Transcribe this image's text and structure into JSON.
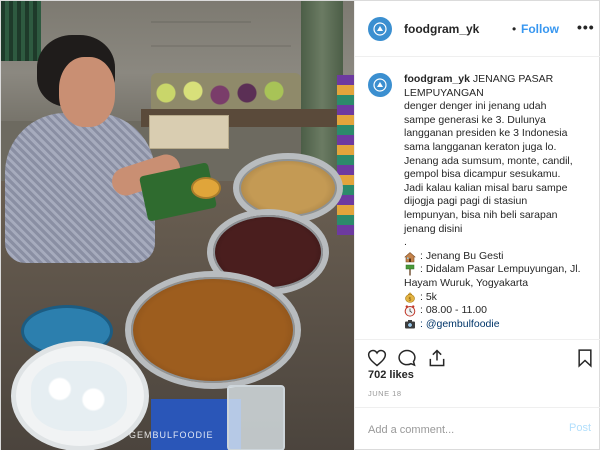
{
  "post": {
    "username": "foodgram_yk",
    "dot": "•",
    "follow_label": "Follow",
    "more_label": "•••",
    "caption": {
      "username": "foodgram_yk",
      "lines": [
        "JENANG PASAR",
        "LEMPUYANGAN",
        "denger denger ini jenang udah",
        "sampe generasi ke 3. Dulunya",
        "langganan presiden ke 3 Indonesia",
        "sama langganan keraton juga lo.",
        "Jenang ada sumsum, monte, candil,",
        "gempol bisa dicampur sesukamu.",
        "Jadi kalau kalian misal baru sampe",
        "dijogja pagi pagi di stasiun",
        "lempunyan, bisa nih beli sarapan",
        "jenang disini",
        "."
      ],
      "details": [
        {
          "icon": "house-icon",
          "text": ": Jenang Bu Gesti"
        },
        {
          "icon": "location-pin-icon",
          "text": ": Didalam Pasar Lempuyungan, Jl."
        },
        {
          "icon": "",
          "text": "Hayam Wuruk, Yogyakarta"
        },
        {
          "icon": "money-bag-icon",
          "text": ": 5k"
        },
        {
          "icon": "clock-icon",
          "text": ": 08.00 - 11.00"
        },
        {
          "icon": "camera-icon",
          "text": ": @gembulfoodie"
        }
      ]
    },
    "likes": "702 likes",
    "date": "JUNE 18",
    "comment_placeholder": "Add a comment...",
    "post_label": "Post",
    "photo_watermark": "GEMBULFOODIE"
  },
  "colors": {
    "link_blue": "#3897f0",
    "post_disabled": "#b2dffc",
    "avatar_blue": "#3b8fd0"
  }
}
